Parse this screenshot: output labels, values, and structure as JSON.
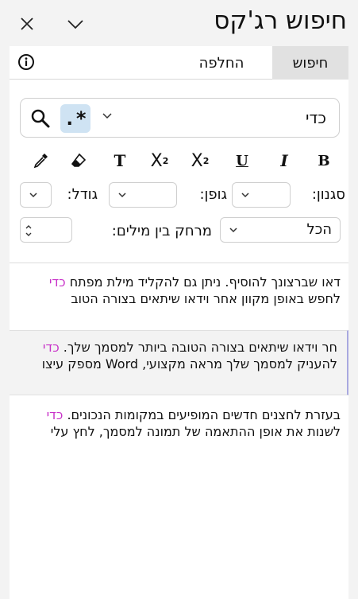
{
  "header": {
    "title": "חיפוש רג'קס",
    "close_icon": "close-icon",
    "collapse_icon": "chevron-down-icon"
  },
  "tabs": [
    {
      "label": "חיפוש",
      "active": true
    },
    {
      "label": "החלפה",
      "active": false
    }
  ],
  "search": {
    "value": "כדי",
    "regex_label": ".*",
    "regex_active": true
  },
  "format_buttons": {
    "bold": "B",
    "italic": "I",
    "underline": "U",
    "superscript": "X",
    "superscript_mark": "2",
    "subscript": "X",
    "subscript_mark": "2",
    "text_color": "T"
  },
  "filters": {
    "style_label": "סגנון:",
    "font_label": "גופן:",
    "size_label": "גודל:",
    "spacing_label": "מרחק בין מילים:",
    "spacing_value": "הכל"
  },
  "results": [
    {
      "before": "דאו שברצונך להוסיף. ניתן גם להקליד מילת מפתח ",
      "match": "כדי",
      "after": " לחפש באופן מקוון אחר וידאו שיתאים בצורה הטוב",
      "selected": false
    },
    {
      "before": "חר וידאו שיתאים בצורה הטובה ביותר למסמך שלך. ",
      "match": "כדי",
      "after": " להעניק למסמך שלך מראה מקצועי, ",
      "tail": "Word",
      "tail_after": " מספק עיצו",
      "selected": true
    },
    {
      "before": "בעזרת לחצנים חדשים המופיעים במקומות הנכונים. ",
      "match": "כדי",
      "after": " לשנות את אופן ההתאמה של תמונה למסמך, לחץ עלי",
      "selected": false
    }
  ],
  "colors": {
    "highlight": "#c832c8",
    "regex_active_bg": "#cfe3f3"
  }
}
